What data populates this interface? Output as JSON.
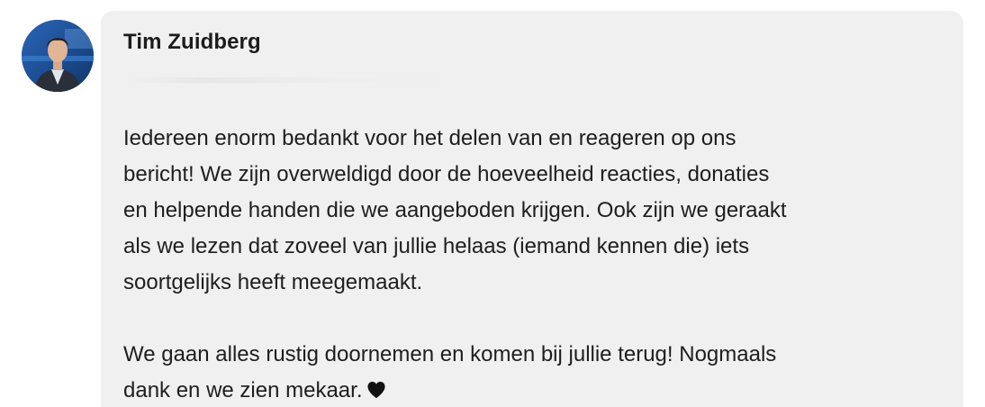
{
  "comment": {
    "author": "Tim Zuidberg",
    "avatar_icon": "user-photo-avatar",
    "paragraphs": [
      "Iedereen enorm bedankt voor het delen van en reageren op ons\nbericht! We zijn overweldigd door de hoeveelheid reacties, donaties\nen helpende handen die we aangeboden krijgen. Ook zijn we geraakt\nals we lezen dat zoveel van jullie helaas (iemand kennen die) iets\nsoortgelijks heeft meegemaakt.",
      "We gaan alles rustig doornemen en komen bij jullie terug! Nogmaals\ndank en we zien mekaar."
    ],
    "closing_emoji": "heart-icon",
    "colors": {
      "bubble": "#f0f0f0",
      "text": "#1e1e1e",
      "heart": "#111111"
    }
  }
}
